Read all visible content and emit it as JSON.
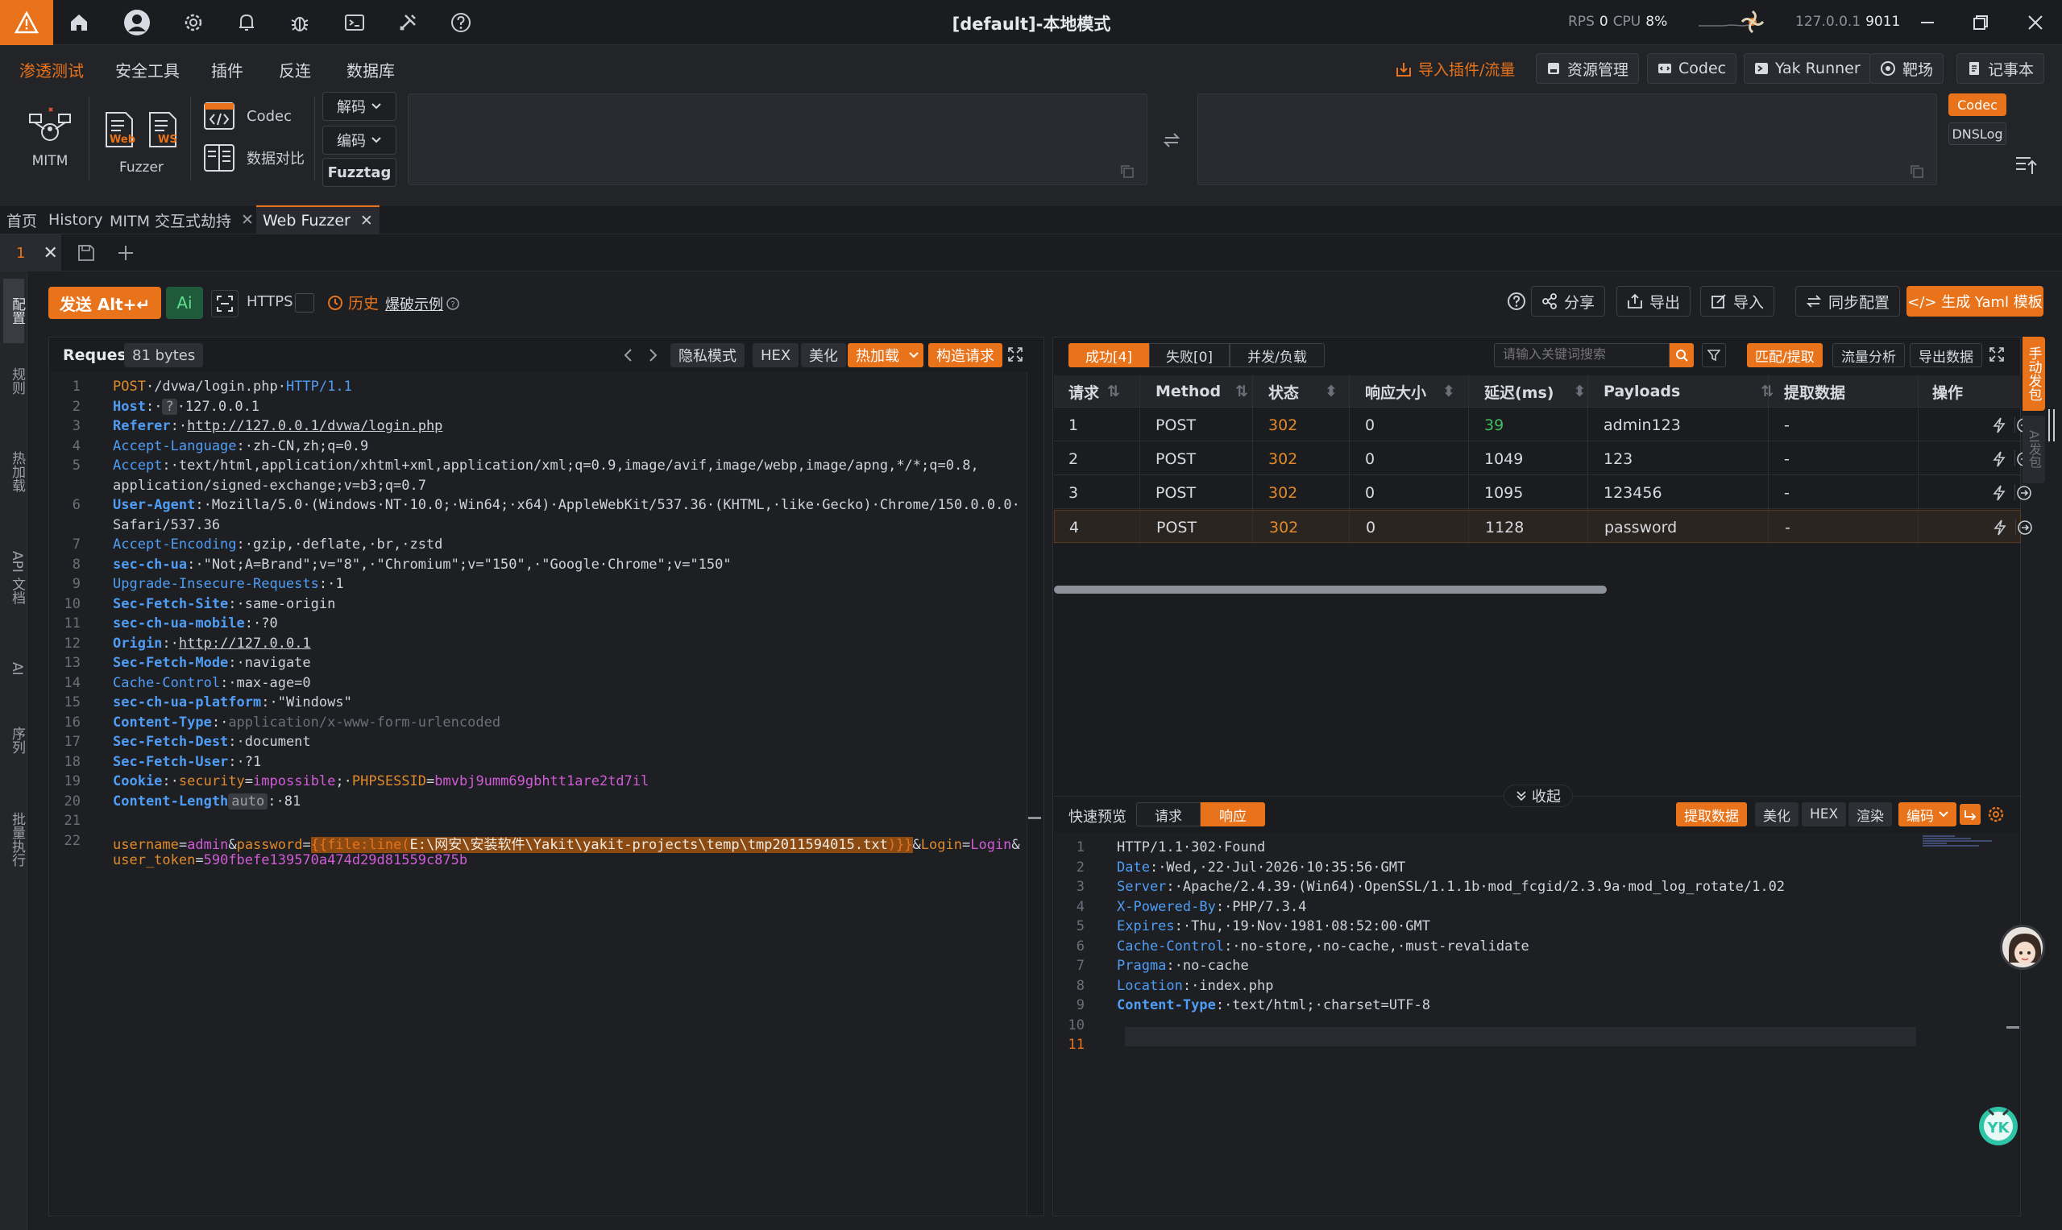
{
  "titlebar": {
    "title": "[default]-本地模式",
    "rps_label": "RPS",
    "rps_value": "0",
    "cpu_label": "CPU",
    "cpu_value": "8%",
    "host": "127.0.0.1",
    "port": "9011"
  },
  "menu": {
    "items": [
      "渗透测试",
      "安全工具",
      "插件",
      "反连",
      "数据库"
    ],
    "right": {
      "import": "导入插件/流量",
      "resources": "资源管理",
      "codec": "Codec",
      "yakrunner": "Yak Runner",
      "target": "靶场",
      "notebook": "记事本"
    }
  },
  "tools": {
    "mitm": "MITM",
    "fuzzer": "Fuzzer",
    "web": "Web",
    "ws": "WS",
    "codec": "Codec",
    "compare": "数据对比",
    "decode": "解码",
    "encode": "编码",
    "fuzztag": "Fuzztag",
    "codec_tag": "Codec",
    "dnslog_tag": "DNSLog"
  },
  "tabs": {
    "home": "首页",
    "history": "History",
    "mitm": "MITM 交互式劫持",
    "webfuzzer": "Web Fuzzer",
    "sub_index": "1"
  },
  "rail": [
    "配置",
    "规则",
    "热加载",
    "API 文档",
    "AI",
    "序列",
    "批量执行"
  ],
  "actions": {
    "send": "发送 Alt+↵",
    "ai": "Ai",
    "https": "HTTPS",
    "history": "历史",
    "example": "爆破示例",
    "share": "分享",
    "export": "导出",
    "import": "导入",
    "sync": "同步配置",
    "yaml": "</> 生成 Yaml 模板"
  },
  "request": {
    "label": "Request",
    "size": "81 bytes",
    "buttons": {
      "privacy": "隐私模式",
      "hex": "HEX",
      "beautify": "美化",
      "hotload": "热加载",
      "build": "构造请求"
    },
    "lines": [
      {
        "n": "1",
        "segs": [
          [
            "org",
            "POST"
          ],
          [
            "val",
            "·/dvwa/login.php·"
          ],
          [
            "key",
            "HTTP/1.1"
          ]
        ]
      },
      {
        "n": "2",
        "segs": [
          [
            "kh",
            "Host"
          ],
          [
            "val",
            ":·"
          ],
          [
            "tag",
            "?"
          ],
          [
            "val",
            "·127.0.0.1"
          ]
        ]
      },
      {
        "n": "3",
        "segs": [
          [
            "kh",
            "Referer"
          ],
          [
            "val",
            ":·"
          ],
          [
            "link",
            "http://127.0.0.1/dvwa/login.php"
          ]
        ]
      },
      {
        "n": "4",
        "segs": [
          [
            "key",
            "Accept-Language"
          ],
          [
            "val",
            ":·zh-CN,zh;q=0.9"
          ]
        ]
      },
      {
        "n": "5",
        "segs": [
          [
            "key",
            "Accept"
          ],
          [
            "val",
            ":·text/html,application/xhtml+xml,application/xml;q=0.9,image/avif,image/webp,image/apng,*/*;q=0.8,"
          ]
        ]
      },
      {
        "n": "",
        "segs": [
          [
            "val",
            "application/signed-exchange;v=b3;q=0.7"
          ]
        ]
      },
      {
        "n": "6",
        "segs": [
          [
            "kh",
            "User-Agent"
          ],
          [
            "val",
            ":·Mozilla/5.0·(Windows·NT·10.0;·Win64;·x64)·AppleWebKit/537.36·(KHTML,·like·Gecko)·Chrome/150.0.0.0·"
          ]
        ]
      },
      {
        "n": "",
        "segs": [
          [
            "val",
            "Safari/537.36"
          ]
        ]
      },
      {
        "n": "7",
        "segs": [
          [
            "key",
            "Accept-Encoding"
          ],
          [
            "val",
            ":·gzip,·deflate,·br,·zstd"
          ]
        ]
      },
      {
        "n": "8",
        "segs": [
          [
            "kh",
            "sec-ch-ua"
          ],
          [
            "val",
            ":·\"Not;A=Brand\";v=\"8\",·\"Chromium\";v=\"150\",·\"Google·Chrome\";v=\"150\""
          ]
        ]
      },
      {
        "n": "9",
        "segs": [
          [
            "key",
            "Upgrade-Insecure-Requests"
          ],
          [
            "val",
            ":·1"
          ]
        ]
      },
      {
        "n": "10",
        "segs": [
          [
            "kh",
            "Sec-Fetch-Site"
          ],
          [
            "val",
            ":·same-origin"
          ]
        ]
      },
      {
        "n": "11",
        "segs": [
          [
            "kh",
            "sec-ch-ua-mobile"
          ],
          [
            "val",
            ":·?0"
          ]
        ]
      },
      {
        "n": "12",
        "segs": [
          [
            "kh",
            "Origin"
          ],
          [
            "val",
            ":·"
          ],
          [
            "link",
            "http://127.0.0.1"
          ]
        ]
      },
      {
        "n": "13",
        "segs": [
          [
            "kh",
            "Sec-Fetch-Mode"
          ],
          [
            "val",
            ":·navigate"
          ]
        ]
      },
      {
        "n": "14",
        "segs": [
          [
            "key",
            "Cache-Control"
          ],
          [
            "val",
            ":·max-age=0"
          ]
        ]
      },
      {
        "n": "15",
        "segs": [
          [
            "kh",
            "sec-ch-ua-platform"
          ],
          [
            "val",
            ":·\"Windows\""
          ]
        ]
      },
      {
        "n": "16",
        "segs": [
          [
            "kh",
            "Content-Type"
          ],
          [
            "val",
            ":·"
          ],
          [
            "dim",
            "application/x-www-form-urlencoded"
          ]
        ]
      },
      {
        "n": "17",
        "segs": [
          [
            "kh",
            "Sec-Fetch-Dest"
          ],
          [
            "val",
            ":·document"
          ]
        ]
      },
      {
        "n": "18",
        "segs": [
          [
            "kh",
            "Sec-Fetch-User"
          ],
          [
            "val",
            ":·?1"
          ]
        ]
      },
      {
        "n": "19",
        "segs": [
          [
            "kh",
            "Cookie"
          ],
          [
            "val",
            ":·"
          ],
          [
            "org",
            "security"
          ],
          [
            "val",
            "="
          ],
          [
            "mag",
            "impossible"
          ],
          [
            "val",
            ";·"
          ],
          [
            "org",
            "PHPSESSID"
          ],
          [
            "val",
            "="
          ],
          [
            "mag",
            "bmvbj9umm69gbhtt1are2td7il"
          ]
        ]
      },
      {
        "n": "20",
        "segs": [
          [
            "kh",
            "Content-Length"
          ],
          [
            "tag",
            "auto"
          ],
          [
            "val",
            ":·81"
          ]
        ]
      },
      {
        "n": "21",
        "segs": []
      },
      {
        "n": "22",
        "segs": [
          [
            "org",
            "username"
          ],
          [
            "val",
            "="
          ],
          [
            "mag",
            "admin"
          ],
          [
            "val",
            "&"
          ],
          [
            "org",
            "password"
          ],
          [
            "val",
            "="
          ],
          [
            "hl",
            "{{file:line("
          ],
          [
            "hlv",
            "E:\\网安\\安装软件\\Yakit\\yakit-projects\\temp\\tmp2011594015.txt"
          ],
          [
            "hl",
            ")}}"
          ],
          [
            "val",
            "&"
          ],
          [
            "org",
            "Login"
          ],
          [
            "val",
            "="
          ],
          [
            "mag",
            "Login"
          ],
          [
            "val",
            "&"
          ]
        ]
      },
      {
        "n": "",
        "segs": [
          [
            "org",
            "user_token"
          ],
          [
            "val",
            "="
          ],
          [
            "mag",
            "590fbefe139570a474d29d81559c875b"
          ]
        ]
      }
    ]
  },
  "results": {
    "tab_success": "成功[4]",
    "tab_fail": "失败[0]",
    "tab_load": "并发/负载",
    "search_placeholder": "请输入关键词搜索",
    "match": "匹配/提取",
    "flow": "流量分析",
    "export": "导出数据",
    "columns": [
      "请求",
      "Method",
      "状态",
      "响应大小",
      "延迟(ms)",
      "Payloads",
      "提取数据",
      "操作"
    ],
    "rows": [
      {
        "id": "1",
        "method": "POST",
        "status": "302",
        "size": "0",
        "delay": "39",
        "payload": "admin123",
        "extract": "-"
      },
      {
        "id": "2",
        "method": "POST",
        "status": "302",
        "size": "0",
        "delay": "1049",
        "payload": "123",
        "extract": "-"
      },
      {
        "id": "3",
        "method": "POST",
        "status": "302",
        "size": "0",
        "delay": "1095",
        "payload": "123456",
        "extract": "-"
      },
      {
        "id": "4",
        "method": "POST",
        "status": "302",
        "size": "0",
        "delay": "1128",
        "payload": "password",
        "extract": "-"
      }
    ],
    "collapse": "收起"
  },
  "preview": {
    "label": "快速预览",
    "tab_req": "请求",
    "tab_resp": "响应",
    "extract": "提取数据",
    "beautify": "美化",
    "hex": "HEX",
    "render": "渲染",
    "encoding": "编码",
    "lines": [
      {
        "n": "1",
        "segs": [
          [
            "val",
            "HTTP/1.1·302·Found"
          ]
        ]
      },
      {
        "n": "2",
        "segs": [
          [
            "key",
            "Date"
          ],
          [
            "val",
            ":·Wed,·22·Jul·2026·10:35:56·GMT"
          ]
        ]
      },
      {
        "n": "3",
        "segs": [
          [
            "key",
            "Server"
          ],
          [
            "val",
            ":·Apache/2.4.39·(Win64)·OpenSSL/1.1.1b·mod_fcgid/2.3.9a·mod_log_rotate/1.02"
          ]
        ]
      },
      {
        "n": "4",
        "segs": [
          [
            "key",
            "X-Powered-By"
          ],
          [
            "val",
            ":·PHP/7.3.4"
          ]
        ]
      },
      {
        "n": "5",
        "segs": [
          [
            "key",
            "Expires"
          ],
          [
            "val",
            ":·Thu,·19·Nov·1981·08:52:00·GMT"
          ]
        ]
      },
      {
        "n": "6",
        "segs": [
          [
            "key",
            "Cache-Control"
          ],
          [
            "val",
            ":·no-store,·no-cache,·must-revalidate"
          ]
        ]
      },
      {
        "n": "7",
        "segs": [
          [
            "key",
            "Pragma"
          ],
          [
            "val",
            ":·no-cache"
          ]
        ]
      },
      {
        "n": "8",
        "segs": [
          [
            "key",
            "Location"
          ],
          [
            "val",
            ":·index.php"
          ]
        ]
      },
      {
        "n": "9",
        "segs": [
          [
            "kh",
            "Content-Type"
          ],
          [
            "val",
            ":·text/html;·charset=UTF-8"
          ]
        ]
      },
      {
        "n": "10",
        "segs": []
      },
      {
        "n": "11",
        "segs": []
      }
    ]
  },
  "side_right": {
    "manual": "手动发包",
    "ai": "AI发包"
  },
  "colors": {
    "accent": "#e8731a",
    "status": "#e08a2b",
    "fast": "#3fbf5f",
    "key": "#4f9df5",
    "value": "#d05bd7"
  }
}
